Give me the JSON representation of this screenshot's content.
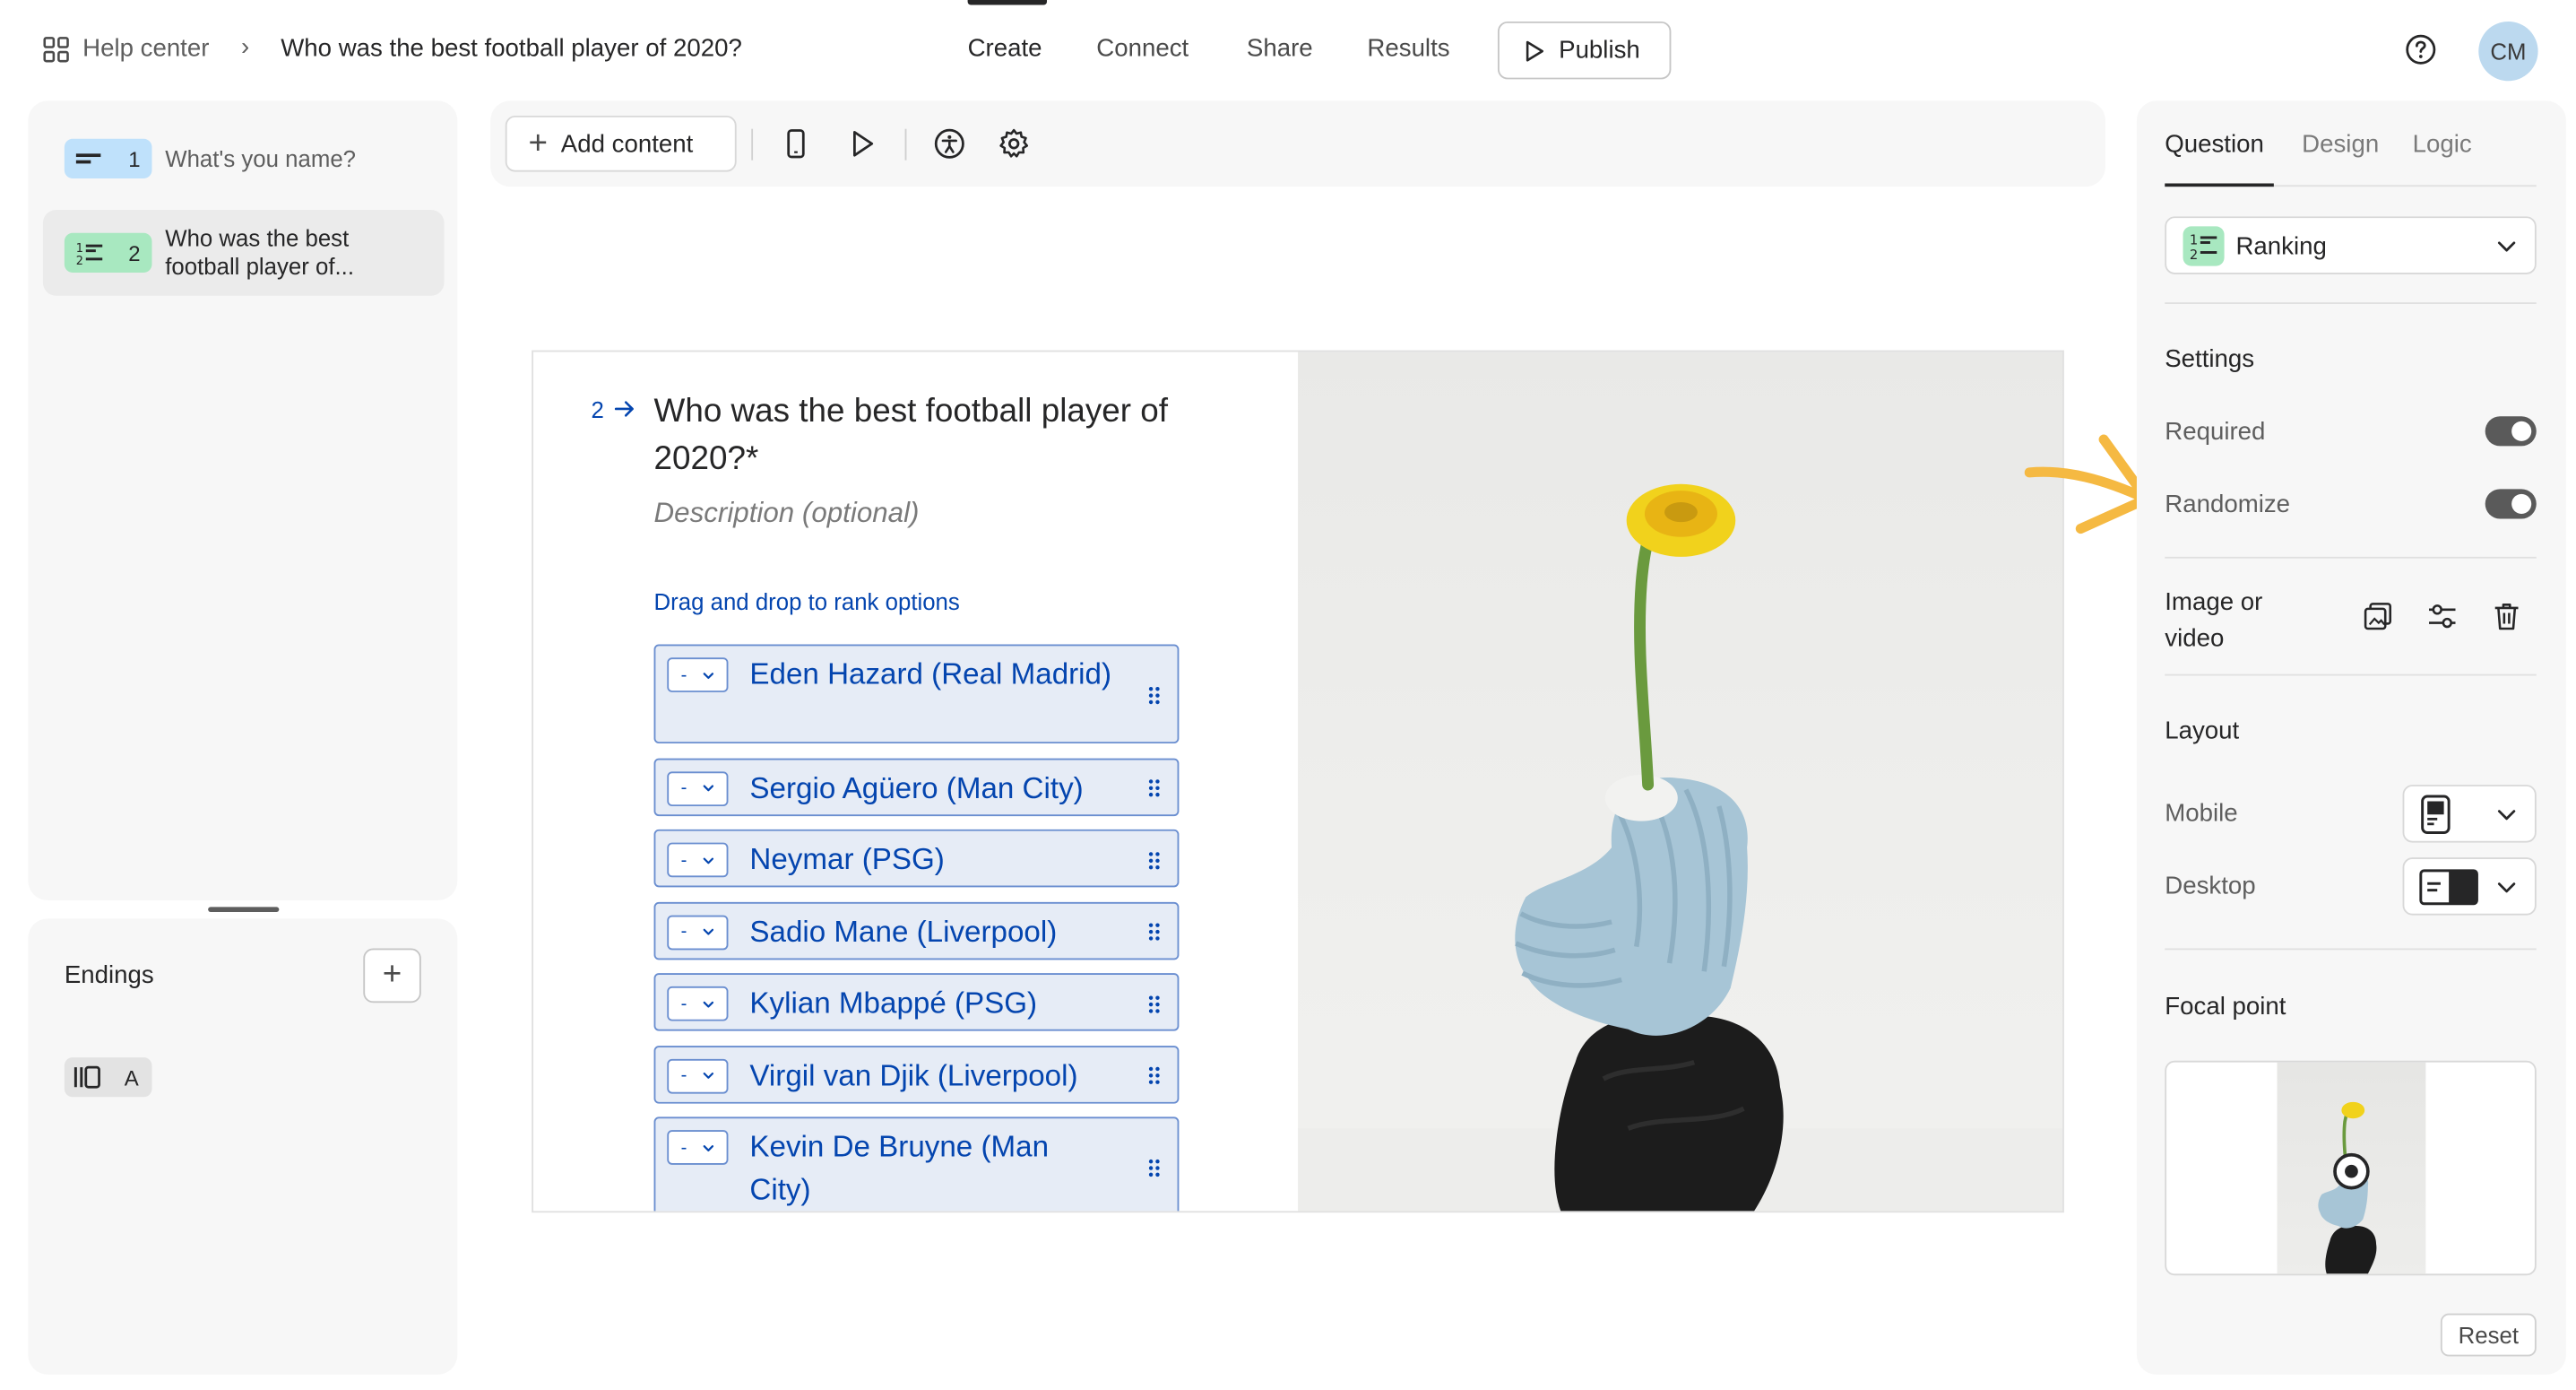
{
  "header": {
    "home_label": "Help center",
    "breadcrumb_sep": "›",
    "form_title": "Who was the best football player of 2020?",
    "tabs": [
      "Create",
      "Connect",
      "Share",
      "Results"
    ],
    "active_tab": "Create",
    "publish_label": "Publish",
    "avatar_initials": "CM"
  },
  "questions": [
    {
      "number": "1",
      "text": "What's you name?",
      "color": "#bfe1fb"
    },
    {
      "number": "2",
      "text": "Who was the best football player of...",
      "color": "#a8e8c0"
    }
  ],
  "endings": {
    "title": "Endings",
    "add_label": "+",
    "items": [
      {
        "label": "A"
      }
    ]
  },
  "toolbar": {
    "add_content_label": "Add content",
    "icons": [
      "mobile-preview-icon",
      "play-icon",
      "accessibility-icon",
      "settings-gear-icon"
    ]
  },
  "canvas": {
    "question_number": "2",
    "question_title": "Who was the best football player of 2020?*",
    "description_placeholder": "Description (optional)",
    "hint": "Drag and drop to rank options",
    "select_placeholder": "-",
    "options": [
      "Eden Hazard (Real Madrid)",
      "Sergio Agüero (Man City)",
      "Neymar (PSG)",
      "Sadio Mane (Liverpool)",
      "Kylian Mbappé (PSG)",
      "Virgil van Djik (Liverpool)",
      "Kevin De Bruyne (Man City)"
    ],
    "accent_color": "#0445af"
  },
  "settings_panel": {
    "tabs": [
      "Question",
      "Design",
      "Logic"
    ],
    "active_tab": "Question",
    "question_type": "Ranking",
    "settings_heading": "Settings",
    "required_label": "Required",
    "required_on": true,
    "randomize_label": "Randomize",
    "randomize_on": true,
    "image_or_video_label": "Image or video",
    "layout_heading": "Layout",
    "mobile_label": "Mobile",
    "desktop_label": "Desktop",
    "focal_point_heading": "Focal point",
    "reset_label": "Reset",
    "annotation_color": "#f5b942"
  }
}
